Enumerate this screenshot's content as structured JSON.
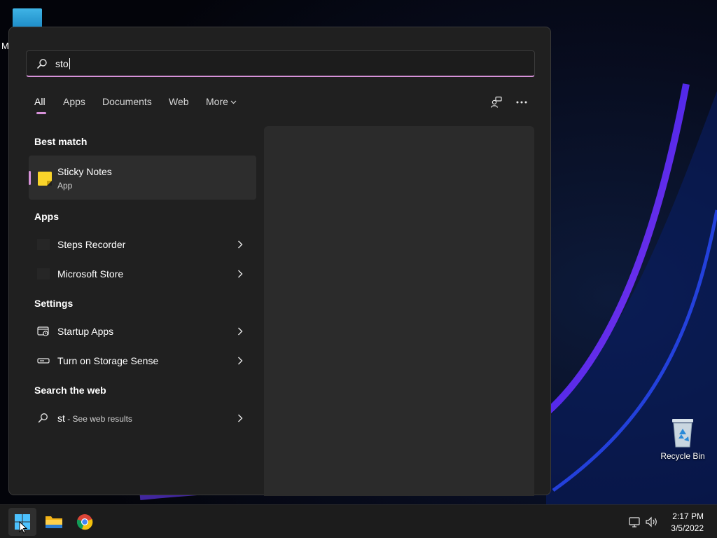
{
  "desktop": {
    "partial_letter": "M",
    "recycle_bin_label": "Recycle Bin"
  },
  "search": {
    "query": "sto"
  },
  "tabs": {
    "all": "All",
    "apps": "Apps",
    "documents": "Documents",
    "web": "Web",
    "more": "More"
  },
  "sections": {
    "best_match": "Best match",
    "apps": "Apps",
    "settings": "Settings",
    "search_web": "Search the web"
  },
  "best_match": {
    "title": "Sticky Notes",
    "subtitle": "App"
  },
  "apps": [
    {
      "label": "Steps Recorder"
    },
    {
      "label": "Microsoft Store"
    }
  ],
  "settings": [
    {
      "label": "Startup Apps",
      "icon": "startup-apps-icon"
    },
    {
      "label": "Turn on Storage Sense",
      "icon": "storage-icon"
    }
  ],
  "web": {
    "query": "st",
    "suffix": " - See web results"
  },
  "taskbar": {
    "time": "2:17 PM",
    "date": "3/5/2022"
  },
  "colors": {
    "accent": "#d792d9",
    "panel": "#202020",
    "preview": "#2b2b2b",
    "taskbar": "#1c1c1c"
  }
}
